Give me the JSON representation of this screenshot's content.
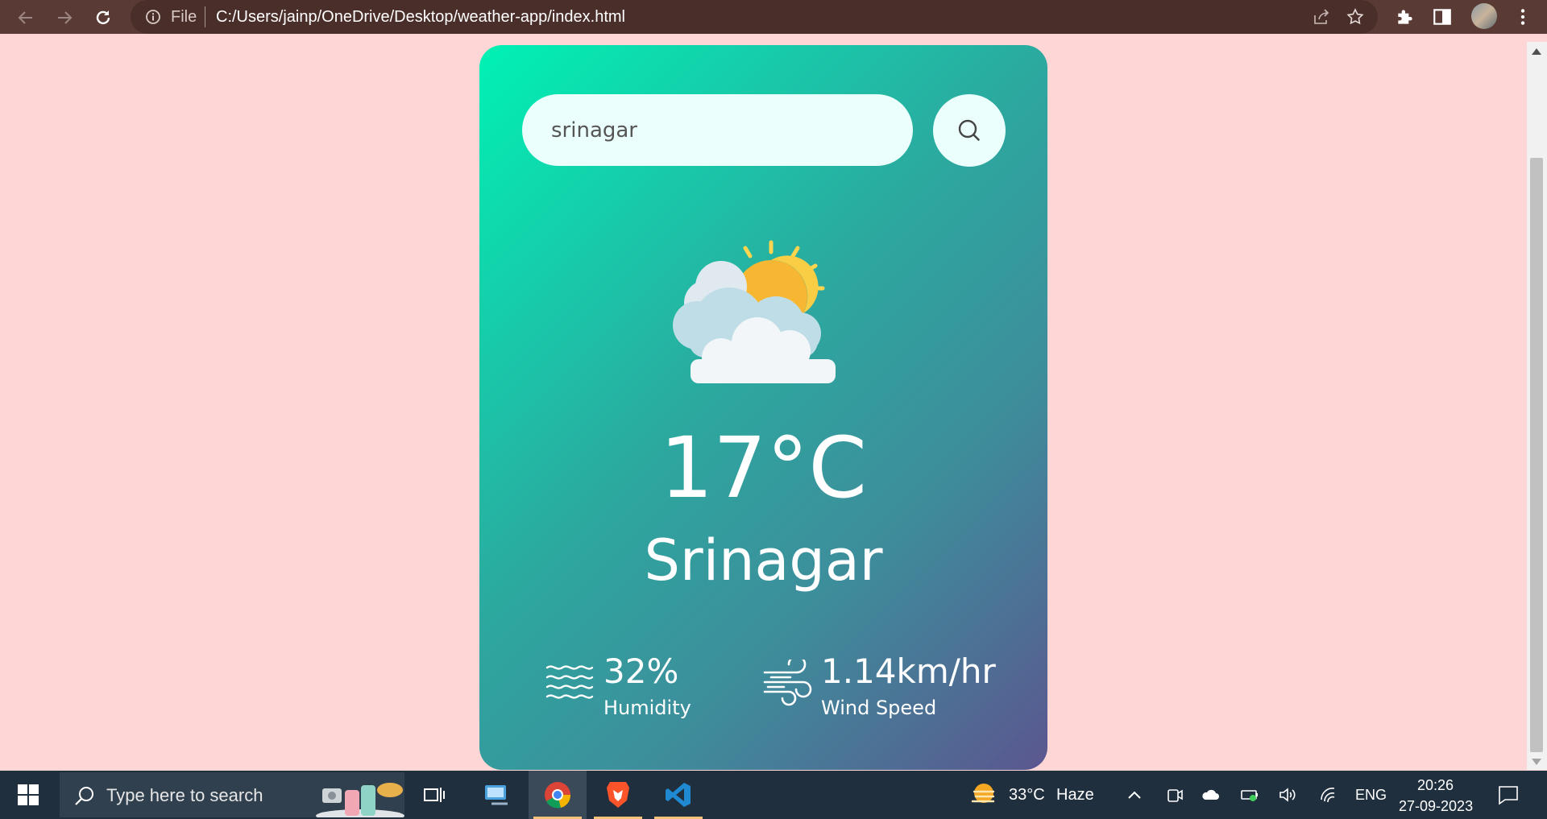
{
  "browser": {
    "file_label": "File",
    "url": "C:/Users/jainp/OneDrive/Desktop/weather-app/index.html"
  },
  "weather": {
    "search_value": "srinagar",
    "temperature": "17°C",
    "city": "Srinagar",
    "humidity_value": "32%",
    "humidity_label": "Humidity",
    "wind_value": "1.14km/hr",
    "wind_label": "Wind Speed",
    "condition_icon": "partly-cloudy-icon"
  },
  "taskbar": {
    "search_placeholder": "Type here to search",
    "weather_temp": "33°C",
    "weather_desc": "Haze",
    "language": "ENG",
    "time": "20:26",
    "date": "27-09-2023"
  },
  "colors": {
    "page_background": "#ffd6d6",
    "card_gradient_start": "#00f2b5",
    "card_gradient_end": "#5b568f",
    "input_background": "#ebfffc"
  }
}
